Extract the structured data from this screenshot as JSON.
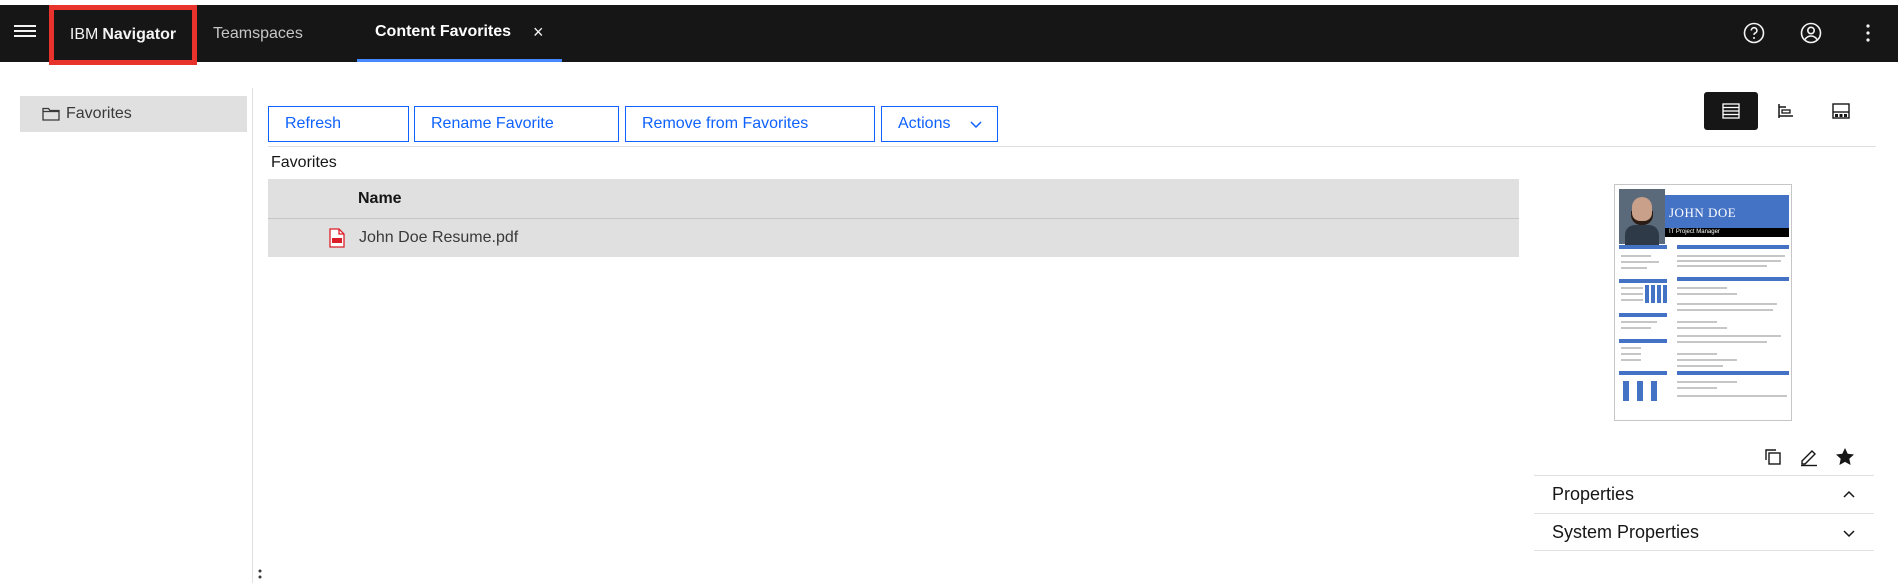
{
  "header": {
    "product_prefix": "IBM",
    "product_name": "Navigator",
    "tabs": [
      {
        "label": "Teamspaces"
      },
      {
        "label": "Content Favorites",
        "close": "×"
      }
    ],
    "icons": [
      "help-icon",
      "user-avatar-icon",
      "overflow-menu-icon"
    ]
  },
  "sidebar": {
    "items": [
      {
        "label": "Favorites",
        "icon": "folder-icon"
      }
    ]
  },
  "toolbar": {
    "refresh_label": "Refresh",
    "rename_label": "Rename Favorite",
    "remove_label": "Remove from Favorites",
    "actions_label": "Actions"
  },
  "view_switcher": {
    "options": [
      "details-view-icon",
      "magazine-view-icon",
      "filmstrip-view-icon"
    ],
    "selected": "details-view-icon"
  },
  "breadcrumb": "Favorites",
  "table": {
    "columns": [
      "Name"
    ],
    "rows": [
      {
        "name": "John Doe Resume.pdf",
        "icon": "pdf-icon"
      }
    ]
  },
  "preview": {
    "name": "JOHN DOE",
    "role": "IT Project Manager"
  },
  "properties_panel": {
    "actions": [
      "copy-icon",
      "edit-icon",
      "star-icon"
    ],
    "sections": [
      {
        "label": "Properties",
        "expanded": true
      },
      {
        "label": "System Properties",
        "expanded": false
      }
    ]
  },
  "colors": {
    "topbar": "#161616",
    "accent": "#0f62fe",
    "highlight_box": "#e8322c",
    "resume_band": "#4472c4"
  }
}
